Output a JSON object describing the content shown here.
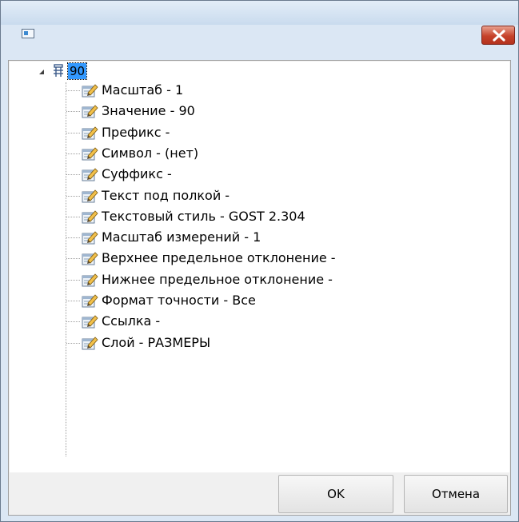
{
  "dialog": {
    "title": "",
    "close_icon": "close-icon",
    "app_icon": "window-app-icon"
  },
  "tree": {
    "root": {
      "label": "90",
      "icon": "dimension-icon",
      "expanded": true
    },
    "items": [
      {
        "label": "Масштаб - 1"
      },
      {
        "label": "Значение - 90"
      },
      {
        "label": "Префикс -"
      },
      {
        "label": "Символ - (нет)"
      },
      {
        "label": "Суффикс -"
      },
      {
        "label": "Текст под полкой -"
      },
      {
        "label": "Текстовый стиль - GOST 2.304"
      },
      {
        "label": "Масштаб измерений - 1"
      },
      {
        "label": "Верхнее предельное отклонение -"
      },
      {
        "label": "Нижнее предельное отклонение -"
      },
      {
        "label": "Формат точности - Все"
      },
      {
        "label": "Ссылка -"
      },
      {
        "label": "Слой - РАЗМЕРЫ"
      }
    ],
    "item_icon": "property-edit-icon"
  },
  "buttons": {
    "ok_label": "OK",
    "cancel_label": "Отмена"
  },
  "colors": {
    "selection": "#3399ff",
    "close_button": "#c6422a",
    "titlebar": "#c9dbee"
  }
}
